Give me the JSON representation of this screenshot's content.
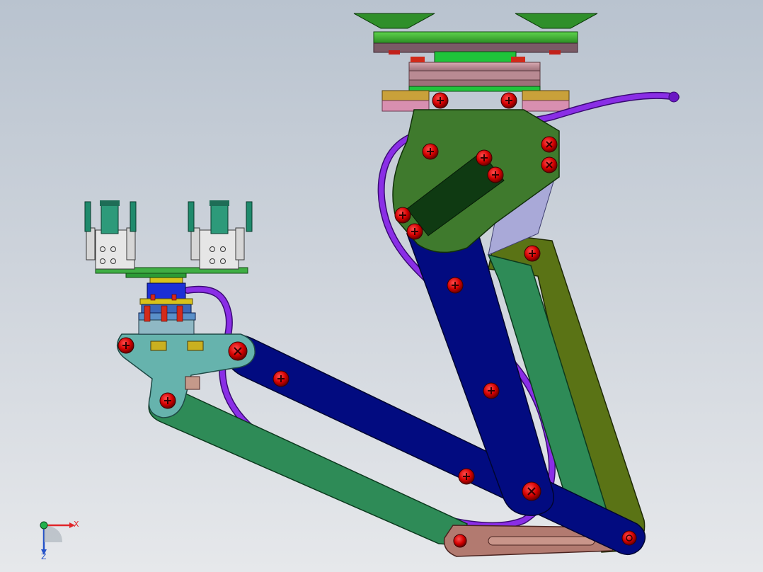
{
  "triad": {
    "x_label": "X",
    "z_label": "Z",
    "x_color": "#e0262a",
    "z_color": "#2452c9",
    "origin_color": "#22b14c"
  },
  "colors": {
    "background_top": "#b9c3cf",
    "background_bottom": "#e6e8eb",
    "upper_arm": "#020b80",
    "forearm": "#020b80",
    "base_plate": "#3f7a2d",
    "green_link": "#2e8b57",
    "olive_link": "#5a7315",
    "wrist_plate": "#66b3ad",
    "elbow_plate": "#b27a70",
    "hose": "#7a1fd6",
    "bolt": "#d40000",
    "mount_top": "#38b52e",
    "flange_pink": "#c09aa0",
    "gold_block": "#c9a13a",
    "slot_dark": "#0f3a12"
  }
}
